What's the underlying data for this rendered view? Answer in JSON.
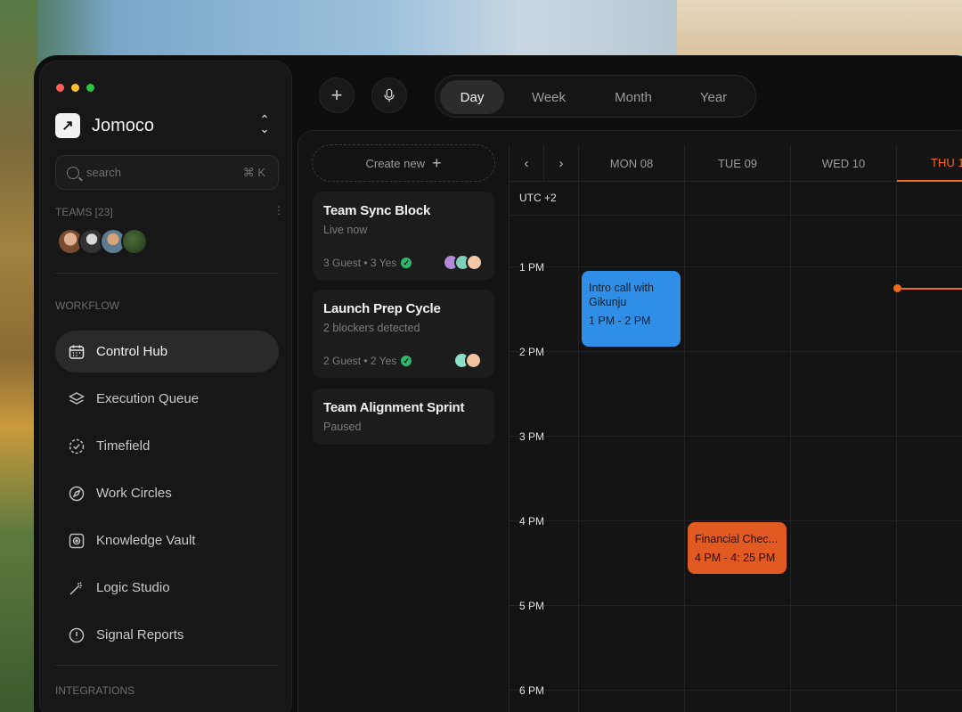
{
  "window": {
    "controls": [
      "close",
      "minimize",
      "maximize"
    ]
  },
  "brand": {
    "name": "Jomoco",
    "logo_glyph": "↗"
  },
  "search": {
    "placeholder": "search",
    "shortcut": "⌘ K"
  },
  "teams": {
    "label": "TEAMS [23]",
    "more": "⋮"
  },
  "workflow": {
    "label": "WORKFLOW",
    "items": [
      {
        "label": "Control Hub",
        "icon": "calendar-icon",
        "active": true
      },
      {
        "label": "Execution Queue",
        "icon": "layers-icon"
      },
      {
        "label": "Timefield",
        "icon": "check-circle-icon"
      },
      {
        "label": "Work Circles",
        "icon": "compass-icon"
      },
      {
        "label": "Knowledge Vault",
        "icon": "vault-icon"
      },
      {
        "label": "Logic Studio",
        "icon": "magic-wand-icon"
      },
      {
        "label": "Signal Reports",
        "icon": "alert-icon"
      }
    ]
  },
  "integrations": {
    "label": "INTEGRATIONS"
  },
  "toolbar": {
    "add_glyph": "+",
    "mic_glyph": "🎙"
  },
  "view_switcher": {
    "options": [
      "Day",
      "Week",
      "Month",
      "Year"
    ],
    "selected": "Day"
  },
  "create": {
    "label": "Create new",
    "glyph": "+"
  },
  "cards": [
    {
      "title": "Team Sync Block",
      "status": "Live now",
      "meta": "3 Guest • 3 Yes"
    },
    {
      "title": "Launch Prep Cycle",
      "status": "2 blockers detected",
      "meta": "2 Guest • 2 Yes"
    },
    {
      "title": "Team Alignment Sprint",
      "status": "Paused"
    }
  ],
  "calendar": {
    "prev": "‹",
    "next": "›",
    "days": [
      "MON 08",
      "TUE 09",
      "WED 10",
      "THU 1"
    ],
    "timezone": "UTC +2",
    "times": [
      "1 PM",
      "2 PM",
      "3 PM",
      "4 PM",
      "5 PM",
      "6 PM"
    ],
    "events": [
      {
        "title": "Intro call with Gikunju",
        "time": "1 PM - 2 PM",
        "color": "#2f8fe6"
      },
      {
        "title": "Financial Chec...",
        "time": "4 PM - 4: 25 PM",
        "color": "#e05a22"
      }
    ],
    "accent": "#ef6a1b"
  }
}
